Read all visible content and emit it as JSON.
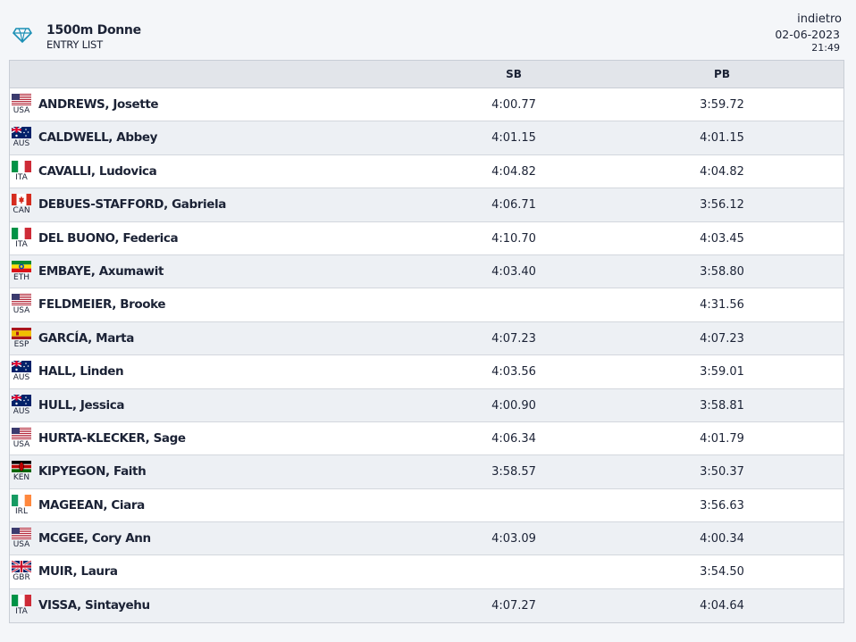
{
  "header": {
    "title": "1500m Donne",
    "subtitle": "ENTRY LIST",
    "back_label": "indietro",
    "date": "02-06-2023",
    "time": "21:49",
    "logo_icon": "diamond-icon",
    "accent_color": "#1a8fb5"
  },
  "table": {
    "columns": [
      "",
      "SB",
      "PB"
    ],
    "rows": [
      {
        "country": "USA",
        "flag_icon": "usa-flag-icon",
        "name": "ANDREWS, Josette",
        "sb": "4:00.77",
        "pb": "3:59.72"
      },
      {
        "country": "AUS",
        "flag_icon": "aus-flag-icon",
        "name": "CALDWELL, Abbey",
        "sb": "4:01.15",
        "pb": "4:01.15"
      },
      {
        "country": "ITA",
        "flag_icon": "ita-flag-icon",
        "name": "CAVALLI, Ludovica",
        "sb": "4:04.82",
        "pb": "4:04.82"
      },
      {
        "country": "CAN",
        "flag_icon": "can-flag-icon",
        "name": "DEBUES-STAFFORD, Gabriela",
        "sb": "4:06.71",
        "pb": "3:56.12"
      },
      {
        "country": "ITA",
        "flag_icon": "ita-flag-icon",
        "name": "DEL BUONO, Federica",
        "sb": "4:10.70",
        "pb": "4:03.45"
      },
      {
        "country": "ETH",
        "flag_icon": "eth-flag-icon",
        "name": "EMBAYE, Axumawit",
        "sb": "4:03.40",
        "pb": "3:58.80"
      },
      {
        "country": "USA",
        "flag_icon": "usa-flag-icon",
        "name": "FELDMEIER, Brooke",
        "sb": "",
        "pb": "4:31.56"
      },
      {
        "country": "ESP",
        "flag_icon": "esp-flag-icon",
        "name": "GARCÍA, Marta",
        "sb": "4:07.23",
        "pb": "4:07.23"
      },
      {
        "country": "AUS",
        "flag_icon": "aus-flag-icon",
        "name": "HALL, Linden",
        "sb": "4:03.56",
        "pb": "3:59.01"
      },
      {
        "country": "AUS",
        "flag_icon": "aus-flag-icon",
        "name": "HULL, Jessica",
        "sb": "4:00.90",
        "pb": "3:58.81"
      },
      {
        "country": "USA",
        "flag_icon": "usa-flag-icon",
        "name": "HURTA-KLECKER, Sage",
        "sb": "4:06.34",
        "pb": "4:01.79"
      },
      {
        "country": "KEN",
        "flag_icon": "ken-flag-icon",
        "name": "KIPYEGON, Faith",
        "sb": "3:58.57",
        "pb": "3:50.37"
      },
      {
        "country": "IRL",
        "flag_icon": "irl-flag-icon",
        "name": "MAGEEAN, Ciara",
        "sb": "",
        "pb": "3:56.63"
      },
      {
        "country": "USA",
        "flag_icon": "usa-flag-icon",
        "name": "MCGEE, Cory Ann",
        "sb": "4:03.09",
        "pb": "4:00.34"
      },
      {
        "country": "GBR",
        "flag_icon": "gbr-flag-icon",
        "name": "MUIR, Laura",
        "sb": "",
        "pb": "3:54.50"
      },
      {
        "country": "ITA",
        "flag_icon": "ita-flag-icon",
        "name": "VISSA, Sintayehu",
        "sb": "4:07.27",
        "pb": "4:04.64"
      }
    ]
  }
}
